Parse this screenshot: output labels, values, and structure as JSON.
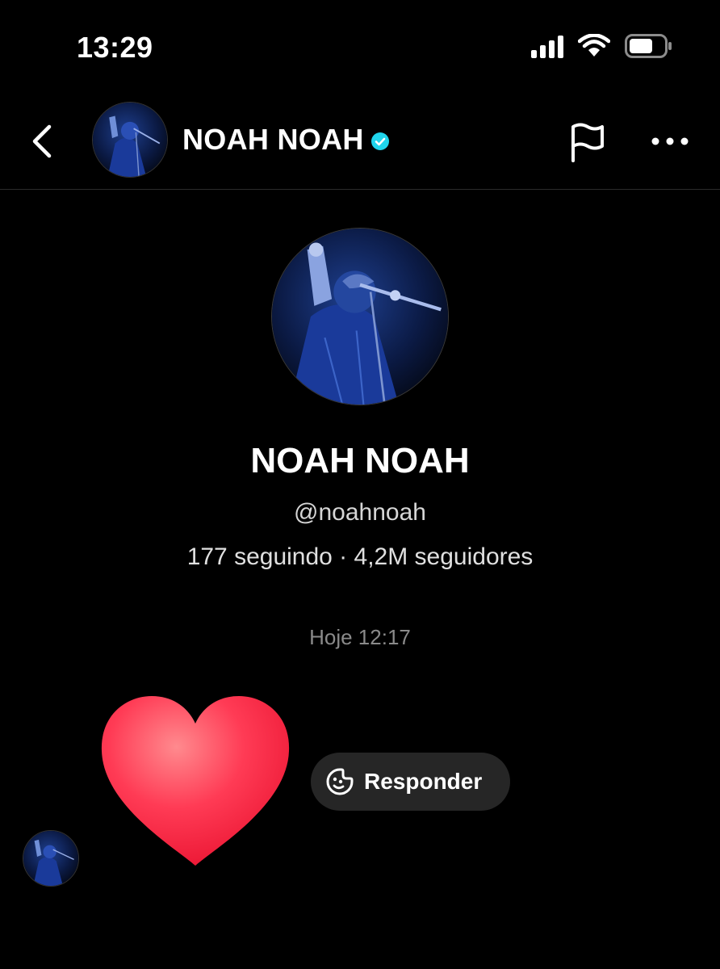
{
  "status_bar": {
    "time": "13:29",
    "icons": [
      "cellular-signal-icon",
      "wifi-icon",
      "battery-icon"
    ]
  },
  "header": {
    "back_icon": "chevron-left-icon",
    "name": "NOAH NOAH",
    "verified_icon": "verified-badge-icon",
    "flag_icon": "flag-icon",
    "more_icon": "more-horizontal-icon"
  },
  "profile": {
    "name": "NOAH NOAH",
    "handle": "@noahnoah",
    "stats": "177 seguindo · 4,2M seguidores"
  },
  "conversation": {
    "timestamp": "Hoje 12:17",
    "message_emoji": "red-heart",
    "reply_icon": "sticker-face-icon",
    "reply_label": "Responder"
  },
  "colors": {
    "background": "#000000",
    "verified": "#20d5ec",
    "reply_bubble": "#262626",
    "heart": "#ff2e4a"
  }
}
